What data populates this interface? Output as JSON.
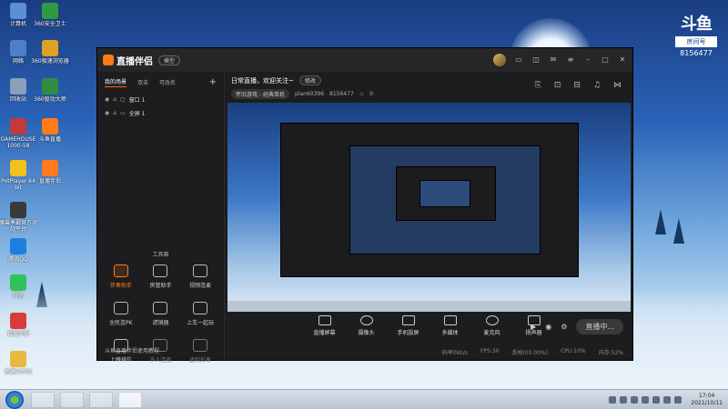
{
  "desktop": {
    "icons": [
      {
        "label": "计算机",
        "color": "#5b8fd6"
      },
      {
        "label": "360安全卫士",
        "color": "#2e9b43"
      },
      {
        "label": "网络",
        "color": "#4e7fc9"
      },
      {
        "label": "360极速浏览器",
        "color": "#e0a222"
      },
      {
        "label": "回收站",
        "color": "#8aa0b8"
      },
      {
        "label": "360驱动大师",
        "color": "#2d8f3d"
      },
      {
        "label": "GAMEHOUSE 1000-58",
        "color": "#c23a3a"
      },
      {
        "label": "斗鱼直播",
        "color": "#ff7a18"
      },
      {
        "label": "PotPlayer 64 bit",
        "color": "#f1c21b"
      },
      {
        "label": "直播伴侣",
        "color": "#ff7a18"
      },
      {
        "label": "魔兽争霸官方对战平台",
        "color": "#3a3a3a"
      },
      {
        "label": "腾讯QQ",
        "color": "#1d7fe0"
      },
      {
        "label": "微信",
        "color": "#2ec25b"
      },
      {
        "label": "直播伴侣",
        "color": "#d93b3b"
      },
      {
        "label": "新建文件夹",
        "color": "#e7b940"
      }
    ],
    "douyu": {
      "mark": "斗鱼",
      "room_label": "房间号",
      "room_number": "8156477"
    }
  },
  "window": {
    "app_name": "直播伴侣",
    "version_badge": "模型",
    "left_tabs": [
      "我的场景",
      "双击",
      "可改名"
    ],
    "sources": [
      {
        "name": "窗口 1"
      },
      {
        "name": "全屏 1"
      }
    ],
    "tools_title": "工具箱",
    "tools": [
      {
        "label": "伴奏助手",
        "state": "active"
      },
      {
        "label": "房管助手",
        "state": "normal"
      },
      {
        "label": "视频连麦",
        "state": "normal"
      },
      {
        "label": "全民连PK",
        "state": "normal"
      },
      {
        "label": "滤镜器",
        "state": "normal"
      },
      {
        "label": "上车一起玩",
        "state": "normal"
      },
      {
        "label": "上榜排位",
        "state": "normal"
      },
      {
        "label": "多人连麦",
        "state": "dim"
      },
      {
        "label": "虚拟形象",
        "state": "dim"
      }
    ],
    "footer_tip": "斗鱼直播伴侣使用教程",
    "live_title": "日常直播，欢迎关注~",
    "edit_button": "修改",
    "category": "怀旧游戏 - 经典单机",
    "user": "plan60396",
    "room": "8156477",
    "likes": "0",
    "controls": [
      {
        "label": "直播屏幕",
        "icon": "screen-icon"
      },
      {
        "label": "摄像头",
        "icon": "camera-icon"
      },
      {
        "label": "手机投屏",
        "icon": "phone-icon"
      },
      {
        "label": "多媒体",
        "icon": "media-icon"
      },
      {
        "label": "麦克风",
        "icon": "mic-icon"
      },
      {
        "label": "扬声器",
        "icon": "speaker-icon"
      }
    ],
    "start_live": "直播中...",
    "status": {
      "bitrate": "码率0kb/s",
      "fps": "FPS:30",
      "loss": "丢帧0(0.00%)",
      "cpu": "CPU:10%",
      "mem": "内存:52%"
    }
  },
  "taskbar": {
    "time": "17:04",
    "date": "2021/10/11"
  }
}
